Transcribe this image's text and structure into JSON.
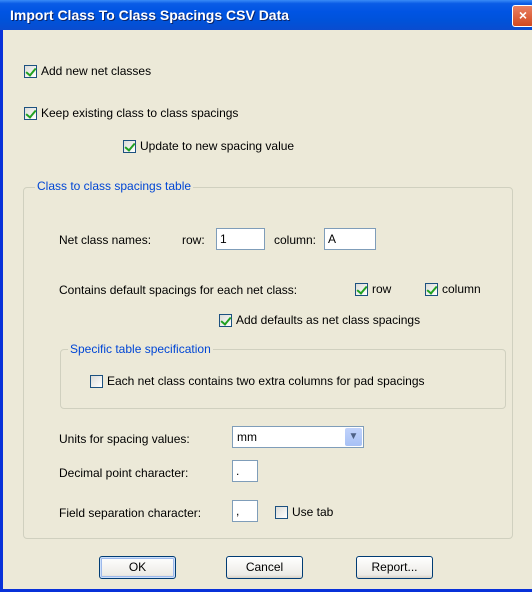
{
  "window": {
    "title": "Import Class To Class Spacings CSV Data",
    "close_glyph": "×"
  },
  "options": {
    "add_new_net_classes": {
      "label": "Add new net classes",
      "checked": true
    },
    "keep_existing": {
      "label": "Keep existing class to class spacings",
      "checked": true
    },
    "update_to_new": {
      "label": "Update to new spacing value",
      "checked": true
    }
  },
  "table_group": {
    "legend": "Class to class spacings table",
    "net_class_names_label": "Net class names:",
    "row_label": "row:",
    "row_value": "1",
    "column_label": "column:",
    "column_value": "A",
    "contains_defaults_label": "Contains default spacings for each net class:",
    "defaults_row": {
      "label": "row",
      "checked": true
    },
    "defaults_column": {
      "label": "column",
      "checked": true
    },
    "add_defaults": {
      "label": "Add defaults as net class spacings",
      "checked": true
    },
    "specific": {
      "legend": "Specific table specification",
      "extra_columns": {
        "label": "Each net class contains two extra columns for pad spacings",
        "checked": false
      }
    },
    "units_label": "Units for spacing values:",
    "units_value": "mm",
    "decimal_label": "Decimal point character:",
    "decimal_value": ".",
    "field_sep_label": "Field separation character:",
    "field_sep_value": ",",
    "use_tab": {
      "label": "Use tab",
      "checked": false
    }
  },
  "buttons": {
    "ok": "OK",
    "cancel": "Cancel",
    "report": "Report..."
  }
}
